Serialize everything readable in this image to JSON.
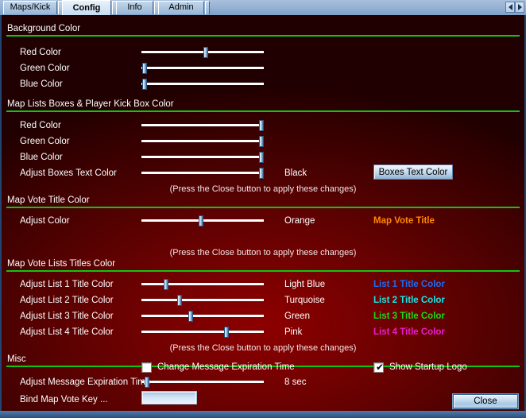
{
  "window": {
    "tabs": [
      {
        "label": "Maps/Kick",
        "active": false
      },
      {
        "label": "Config",
        "active": true
      },
      {
        "label": "Info",
        "active": false
      },
      {
        "label": "Admin",
        "active": false
      }
    ],
    "tab_scroll_left": "◀",
    "tab_scroll_right": "▶"
  },
  "sections": {
    "background_color": {
      "title": "Background Color",
      "rows": [
        {
          "label": "Red Color",
          "thumb_pct": 52
        },
        {
          "label": "Green Color",
          "thumb_pct": 1
        },
        {
          "label": "Blue Color",
          "thumb_pct": 1
        }
      ]
    },
    "boxes_color": {
      "title": "Map Lists Boxes & Player Kick Box Color",
      "rows": [
        {
          "label": "Red Color",
          "thumb_pct": 99,
          "value": ""
        },
        {
          "label": "Green Color",
          "thumb_pct": 99,
          "value": ""
        },
        {
          "label": "Blue Color",
          "thumb_pct": 99,
          "value": ""
        },
        {
          "label": "Adjust Boxes Text Color",
          "thumb_pct": 99,
          "value": "Black"
        }
      ],
      "button_label": "Boxes Text Color",
      "hint": "(Press the Close button to apply these changes)"
    },
    "map_vote_title_color": {
      "title": "Map Vote Title Color",
      "rows": [
        {
          "label": "Adjust Color",
          "thumb_pct": 48,
          "value": "Orange"
        }
      ],
      "sample_text": "Map Vote Title",
      "sample_color": "#ff8800",
      "hint": "(Press the Close button to apply these changes)"
    },
    "map_vote_lists_titles_color": {
      "title": "Map Vote Lists Titles Color",
      "rows": [
        {
          "label": "Adjust List 1 Title Color",
          "thumb_pct": 19,
          "value": "Light Blue",
          "sample_text": "List 1 Title Color",
          "sample_color": "#1b6cf5"
        },
        {
          "label": "Adjust List 2 Title Color",
          "thumb_pct": 30,
          "value": "Turquoise",
          "sample_text": "List 2 Title Color",
          "sample_color": "#16e8e8"
        },
        {
          "label": "Adjust List 3 Title Color",
          "thumb_pct": 39,
          "value": "Green",
          "sample_text": "List 3 Title Color",
          "sample_color": "#16dd16"
        },
        {
          "label": "Adjust List 4 Title Color",
          "thumb_pct": 68,
          "value": "Pink",
          "sample_text": "List 4 Title Color",
          "sample_color": "#f01ad0"
        }
      ],
      "hint": "(Press the Close button to apply these changes)"
    },
    "misc": {
      "title": "Misc",
      "change_msg_checkbox": {
        "label": "Change Message Expiration Time",
        "checked": false
      },
      "show_logo_checkbox": {
        "label": "Show Startup Logo",
        "checked": true,
        "tick": "✔"
      },
      "expiration_row": {
        "label": "Adjust Message Expiration Time",
        "thumb_pct": 3,
        "value": "8 sec"
      },
      "bind_key_row": {
        "label": "Bind Map Vote Key ...",
        "value": ""
      },
      "close_button": "Close"
    }
  }
}
